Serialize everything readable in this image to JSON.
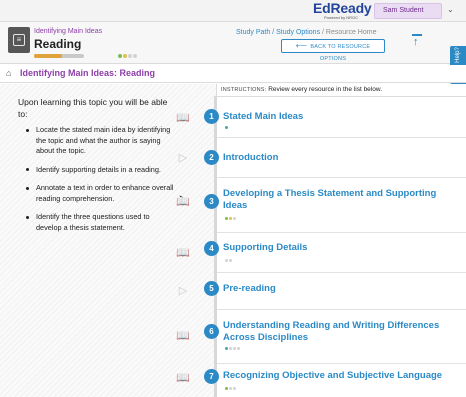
{
  "brand": {
    "name": "EdReady",
    "powered_by": "Powered by NROC"
  },
  "user": {
    "name": "Sam Student",
    "caret": "⌄"
  },
  "topic": {
    "kicker": "Identifying Main Ideas",
    "title": "Reading",
    "progress_fraction": 0.55,
    "progress_label": "",
    "mastery_dots": [
      "green",
      "yellow",
      "grey",
      "grey"
    ]
  },
  "breadcrumb": {
    "part1": "Study Path",
    "sep1": " / ",
    "part2": "Study Options",
    "sep2": " / ",
    "current": "Resource Home"
  },
  "back_button": {
    "arrow": "⟵",
    "label": "BACK TO RESOURCE OPTIONS"
  },
  "scroll_top_icon": "arrow-up-icon",
  "help_tab": {
    "label": "Need Help?"
  },
  "section": {
    "home_glyph": "⌂",
    "title": "Identifying Main Ideas: Reading"
  },
  "objectives": {
    "lead": "Upon learning this topic you will be able to:",
    "items": [
      "Locate the stated main idea by identifying the topic and what the author is saying about the topic.",
      "Identify supporting details in a reading.",
      "Annotate a text in order to enhance overall reading comprehension.",
      "Identify the three questions used to develop a thesis statement."
    ]
  },
  "instructions": {
    "label": "INSTRUCTIONS:",
    "text": " Review every resource in the list below."
  },
  "resources": [
    {
      "number": "1",
      "title": "Stated Main Ideas",
      "icon": "book-icon",
      "glyph": "📖",
      "dots": [
        "teal"
      ]
    },
    {
      "number": "2",
      "title": "Introduction",
      "icon": "video-icon",
      "glyph": "▷",
      "dots": []
    },
    {
      "number": "3",
      "title": "Developing a Thesis Statement and Supporting Ideas",
      "icon": "book-icon",
      "glyph": "📖",
      "dots": [
        "green",
        "yellow",
        "grey"
      ]
    },
    {
      "number": "4",
      "title": "Supporting Details",
      "icon": "video-book-icon",
      "glyph": "📖",
      "dots": [
        "grey",
        "grey"
      ]
    },
    {
      "number": "5",
      "title": "Pre-reading",
      "icon": "video-icon",
      "glyph": "▷",
      "dots": []
    },
    {
      "number": "6",
      "title": "Understanding Reading and Writing Differences Across Disciplines",
      "icon": "book-icon",
      "glyph": "📖",
      "dots": [
        "teal",
        "grey",
        "grey",
        "grey"
      ]
    },
    {
      "number": "7",
      "title": "Recognizing Objective and Subjective Language",
      "icon": "book-icon",
      "glyph": "📖",
      "dots": [
        "green",
        "grey",
        "grey"
      ]
    }
  ],
  "colors": {
    "brand_blue": "#23459b",
    "link_blue": "#2b8ac6",
    "purple": "#8d3fa8",
    "green": "#7bbd4f",
    "yellow": "#e0c14c",
    "teal": "#4aa8a0"
  }
}
